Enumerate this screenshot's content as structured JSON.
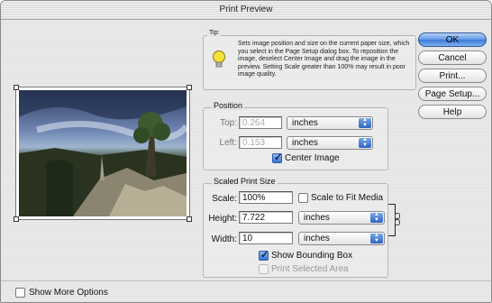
{
  "window": {
    "title": "Print Preview"
  },
  "tip": {
    "group_label": "Tip:",
    "text": "Sets image position and size on the current paper size, which you select in the Page Setup dialog box. To reposition the image, deselect Center Image and drag the image in the preview. Setting Scale greater than 100% may result in poor image quality.",
    "icon": "lightbulb-icon"
  },
  "position": {
    "group_label": "Position",
    "top_label": "Top:",
    "top_value": "0.264",
    "top_unit": "inches",
    "left_label": "Left:",
    "left_value": "0.153",
    "left_unit": "inches",
    "center_image_label": "Center Image",
    "center_image_checked": true
  },
  "scaled": {
    "group_label": "Scaled Print Size",
    "scale_label": "Scale:",
    "scale_value": "100%",
    "scale_to_fit_label": "Scale to Fit Media",
    "height_label": "Height:",
    "height_value": "7.722",
    "height_unit": "inches",
    "width_label": "Width:",
    "width_value": "10",
    "width_unit": "inches",
    "show_bounding_box_label": "Show Bounding Box",
    "print_selected_area_label": "Print Selected Area"
  },
  "buttons": {
    "ok": "OK",
    "cancel": "Cancel",
    "print": "Print...",
    "page_setup": "Page Setup...",
    "help": "Help"
  },
  "footer": {
    "show_more_options_label": "Show More Options"
  },
  "colors": {
    "default_button": "#3b78d8",
    "window_bg": "#e6e6e6",
    "popup_arrow": "#2a64c4"
  }
}
